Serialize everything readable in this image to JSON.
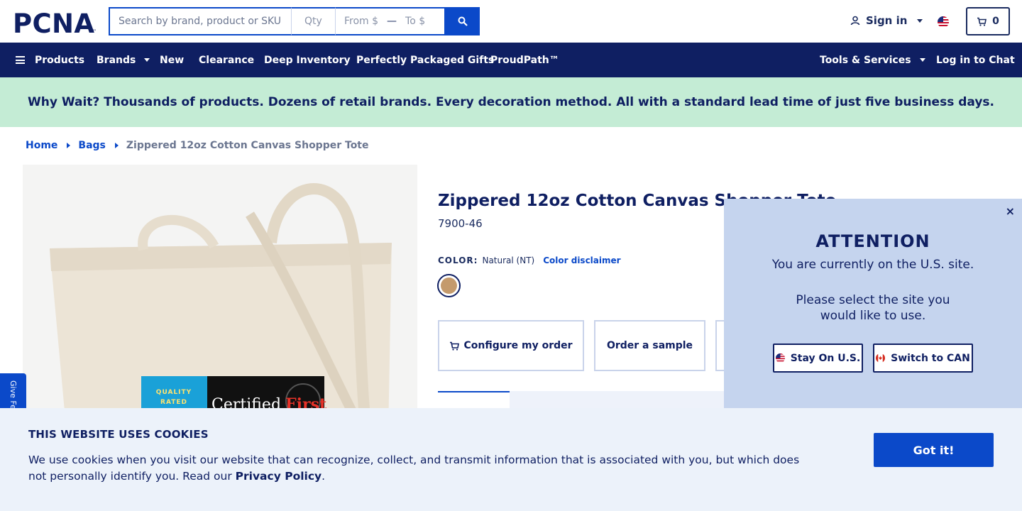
{
  "header": {
    "logo_text": "PCNA",
    "search": {
      "placeholder": "Search by brand, product or SKU"
    },
    "qty": {
      "placeholder": "Qty"
    },
    "price_from": {
      "placeholder": "From $"
    },
    "price_to": {
      "placeholder": "To $"
    },
    "sign_in_label": "Sign in",
    "cart_count": "0"
  },
  "nav": {
    "products": "Products",
    "brands": "Brands",
    "new": "New",
    "clearance": "Clearance",
    "deep_inventory": "Deep Inventory",
    "packaged_gifts": "Perfectly Packaged Gifts",
    "proudpath": "ProudPath™",
    "tools": "Tools & Services",
    "chat": "Log in to Chat"
  },
  "promo": {
    "text": "Why Wait? Thousands of products. Dozens of retail brands. Every decoration method. All with a standard lead time of just five business days."
  },
  "breadcrumb": {
    "home": "Home",
    "bags": "Bags",
    "current": "Zippered 12oz Cotton Canvas Shopper Tote"
  },
  "feedback": {
    "label": "Give Fe"
  },
  "product": {
    "title": "Zippered 12oz Cotton Canvas Shopper Tote",
    "sku": "7900-46",
    "color_label": "COLOR:",
    "color_value": "Natural (NT)",
    "color_disclaimer": "Color disclaimer",
    "swatch_color": "#c49a6c",
    "configure_label": "Configure my order",
    "sample_label": "Order a sample",
    "image_badge_left_top": "QUALITY",
    "image_badge_left_bottom": "RATED",
    "image_badge_right": "Certified"
  },
  "attention": {
    "close": "×",
    "title": "ATTENTION",
    "line1": "You are currently on the U.S. site.",
    "line2": "Please select the site you would like to use.",
    "stay_us": "Stay On U.S.",
    "switch_can": "Switch to CAN"
  },
  "cookie": {
    "title": "THIS WEBSITE USES COOKIES",
    "body": "We use cookies when you visit our website that can recognize, collect, and transmit information that is associated with you, but which does not personally identify you. Read our ",
    "policy_link": "Privacy Policy",
    "period": ".",
    "button": "Got it!"
  },
  "colors": {
    "navy": "#0f1f62",
    "blue": "#0b49c9",
    "mint": "#c4ecd5",
    "popup": "#c5d4ee"
  }
}
